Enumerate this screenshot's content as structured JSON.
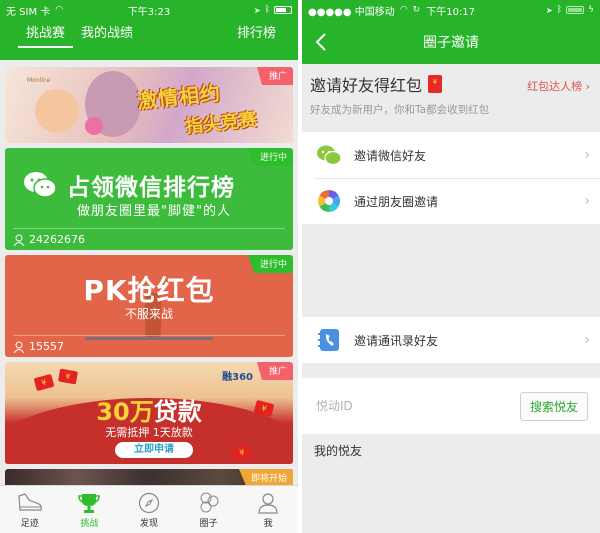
{
  "left_screen": {
    "status_bar": {
      "carrier": "无 SIM 卡",
      "time": "下午3:23",
      "battery_level": 0.7
    },
    "tabs": [
      {
        "label": "挑战赛",
        "active": true
      },
      {
        "label": "我的战绩",
        "active": false
      },
      {
        "label": "排行榜",
        "active": false
      }
    ],
    "cards": [
      {
        "badge": "推广",
        "logo": "Monline",
        "title_line1": "激情相约",
        "title_line2": "指尖竞赛"
      },
      {
        "badge": "进行中",
        "title": "占领微信排行榜",
        "subtitle": "做朋友圈里最\"脚健\"的人",
        "participants": "24262676"
      },
      {
        "badge": "进行中",
        "title": "PK抢红包",
        "subtitle": "不服来战",
        "participants": "15557"
      },
      {
        "badge": "推广",
        "brand": "融360",
        "title_amount": "30万",
        "title_rest": "贷款",
        "subtitle": "无需抵押 1天放款",
        "button": "立即申请"
      },
      {
        "badge": "即将开始"
      }
    ],
    "tabbar": [
      {
        "label": "足迹",
        "icon": "shoe-icon",
        "active": false
      },
      {
        "label": "挑战",
        "icon": "trophy-icon",
        "active": true
      },
      {
        "label": "发现",
        "icon": "compass-icon",
        "active": false
      },
      {
        "label": "圈子",
        "icon": "circles-icon",
        "active": false
      },
      {
        "label": "我",
        "icon": "person-icon",
        "active": false
      }
    ]
  },
  "right_screen": {
    "status_bar": {
      "carrier": "●●●●● 中国移动",
      "time": "下午10:17",
      "battery_level": 1.0,
      "charging": true
    },
    "nav": {
      "title": "圈子邀请"
    },
    "invite": {
      "title": "邀请好友得红包",
      "rank_link": "红包达人榜",
      "subtitle": "好友成为新用户，你和Ta都会收到红包"
    },
    "invite_options": [
      {
        "label": "邀请微信好友",
        "icon": "wechat-icon"
      },
      {
        "label": "通过朋友圈邀请",
        "icon": "moments-icon"
      }
    ],
    "contacts_option": {
      "label": "邀请通讯录好友",
      "icon": "contacts-icon"
    },
    "search": {
      "placeholder": "悦动ID",
      "value": "",
      "button": "搜索悦友"
    },
    "my_friends_label": "我的悦友"
  },
  "colors": {
    "brand_green": "#27b32a",
    "promo_red": "#f4616a",
    "live_green": "#2ebd2c",
    "soon_orange": "#f1a534",
    "link_red": "#e0534f"
  }
}
